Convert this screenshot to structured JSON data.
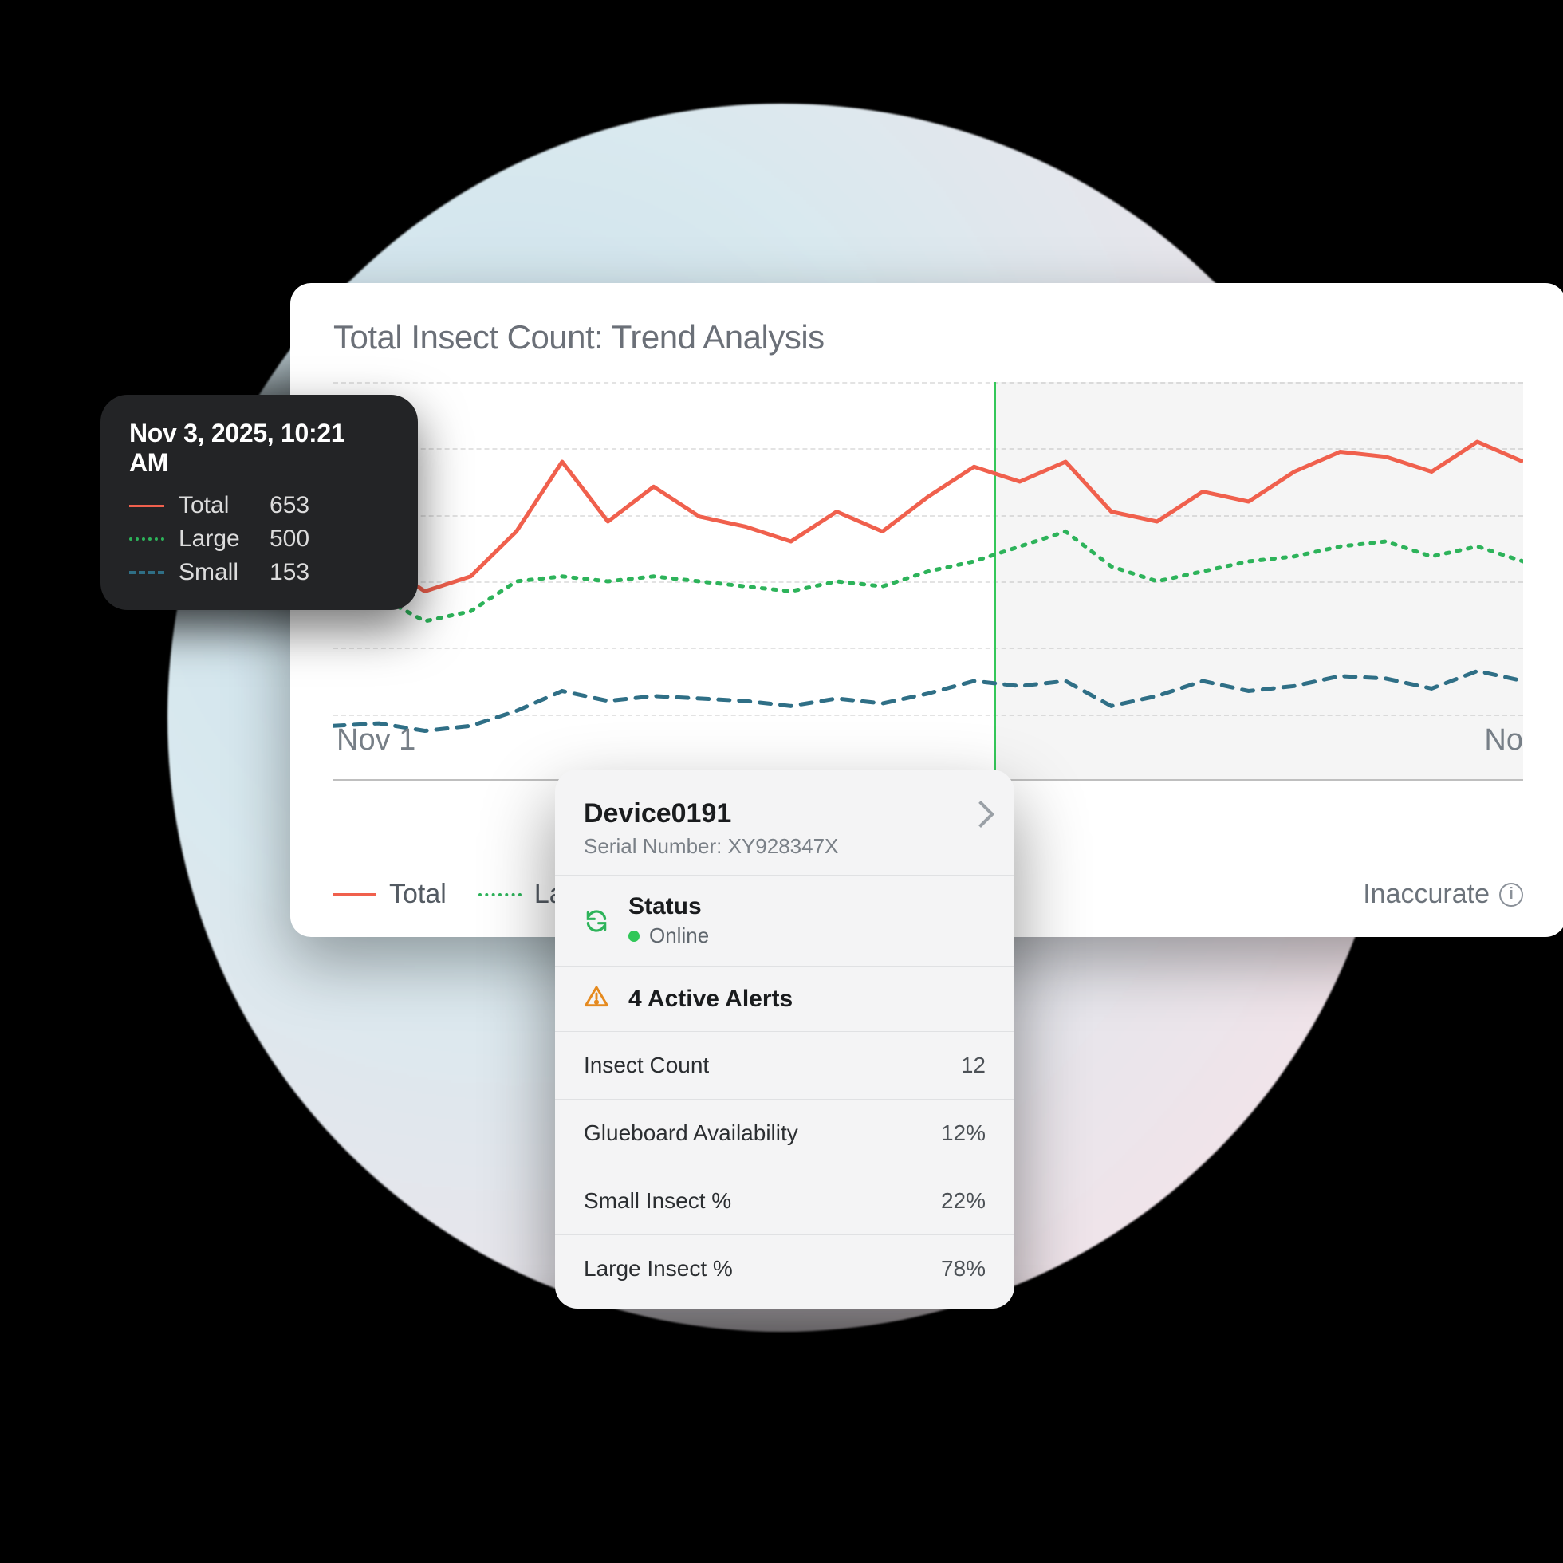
{
  "chart": {
    "title": "Total Insect Count: Trend Analysis",
    "x_ticks": [
      "Nov 1",
      "No"
    ],
    "y_range": [
      0,
      800
    ],
    "marker_x_frac": 0.555,
    "shade_from_frac": 0.555,
    "legend": {
      "total": "Total",
      "large": "Large",
      "inaccurate": "Inaccurate",
      "info_glyph": "i"
    }
  },
  "chart_data": {
    "type": "line",
    "xlabel": "",
    "ylabel": "",
    "ylim": [
      0,
      800
    ],
    "x_index": [
      0,
      1,
      2,
      3,
      4,
      5,
      6,
      7,
      8,
      9,
      10,
      11,
      12,
      13,
      14,
      15,
      16,
      17,
      18,
      19,
      20,
      21,
      22,
      23,
      24,
      25,
      26
    ],
    "series": [
      {
        "name": "Total",
        "style": "solid",
        "color": "#f0604d",
        "values": [
          430,
          440,
          380,
          410,
          500,
          640,
          520,
          590,
          530,
          510,
          480,
          540,
          500,
          570,
          630,
          600,
          640,
          540,
          520,
          580,
          560,
          620,
          660,
          650,
          620,
          680,
          640
        ]
      },
      {
        "name": "Large",
        "style": "dotted",
        "color": "#2db35a",
        "values": [
          360,
          370,
          320,
          340,
          400,
          410,
          400,
          410,
          400,
          390,
          380,
          400,
          390,
          420,
          440,
          470,
          500,
          430,
          400,
          420,
          440,
          450,
          470,
          480,
          450,
          470,
          440
        ]
      },
      {
        "name": "Small",
        "style": "dashed",
        "color": "#2f6f86",
        "values": [
          110,
          115,
          100,
          110,
          140,
          180,
          160,
          170,
          165,
          160,
          150,
          165,
          155,
          175,
          200,
          190,
          200,
          150,
          170,
          200,
          180,
          190,
          210,
          205,
          185,
          220,
          200
        ]
      }
    ],
    "marker": {
      "index": 15,
      "date_label": "Nov 3, 2025, 10:21 AM",
      "total": 653,
      "large": 500,
      "small": 153
    }
  },
  "tooltip": {
    "date": "Nov 3, 2025, 10:21 AM",
    "rows": [
      {
        "label": "Total",
        "value": "653"
      },
      {
        "label": "Large",
        "value": "500"
      },
      {
        "label": "Small",
        "value": "153"
      }
    ]
  },
  "device": {
    "name": "Device0191",
    "serial_label": "Serial Number: XY928347X",
    "status_title": "Status",
    "status_value": "Online",
    "alerts_text": "4 Active Alerts",
    "rows": [
      {
        "k": "Insect Count",
        "v": "12"
      },
      {
        "k": "Glueboard Availability",
        "v": "12%"
      },
      {
        "k": "Small Insect %",
        "v": "22%"
      },
      {
        "k": "Large Insect %",
        "v": "78%"
      }
    ]
  },
  "colors": {
    "total": "#f0604d",
    "large": "#2db35a",
    "small": "#2f6f86",
    "online": "#30c758",
    "warn": "#e58a1f"
  }
}
